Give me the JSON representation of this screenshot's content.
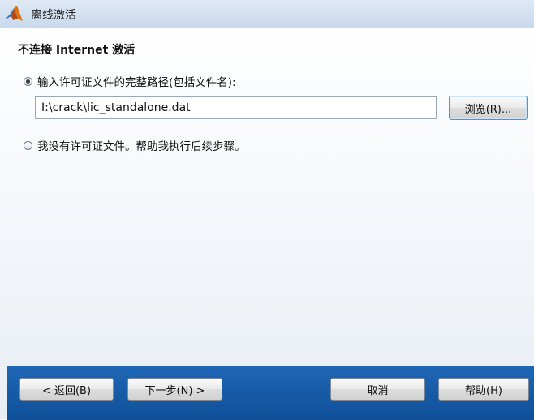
{
  "window": {
    "title": "离线激活"
  },
  "page": {
    "heading": "不连接 Internet 激活"
  },
  "options": {
    "enter_path_label": "输入许可证文件的完整路径(包括文件名):",
    "no_license_label": "我没有许可证文件。帮助我执行后续步骤。"
  },
  "path_input": {
    "value": "I:\\crack\\lic_standalone.dat"
  },
  "buttons": {
    "browse": "浏览(R)...",
    "back": "< 返回(B)",
    "next": "下一步(N) >",
    "cancel": "取消",
    "help": "帮助(H)"
  },
  "colors": {
    "footer": "#1a5fae",
    "title_bar": "#d6e3f2"
  },
  "icons": {
    "app": "matlab-logo-icon"
  }
}
